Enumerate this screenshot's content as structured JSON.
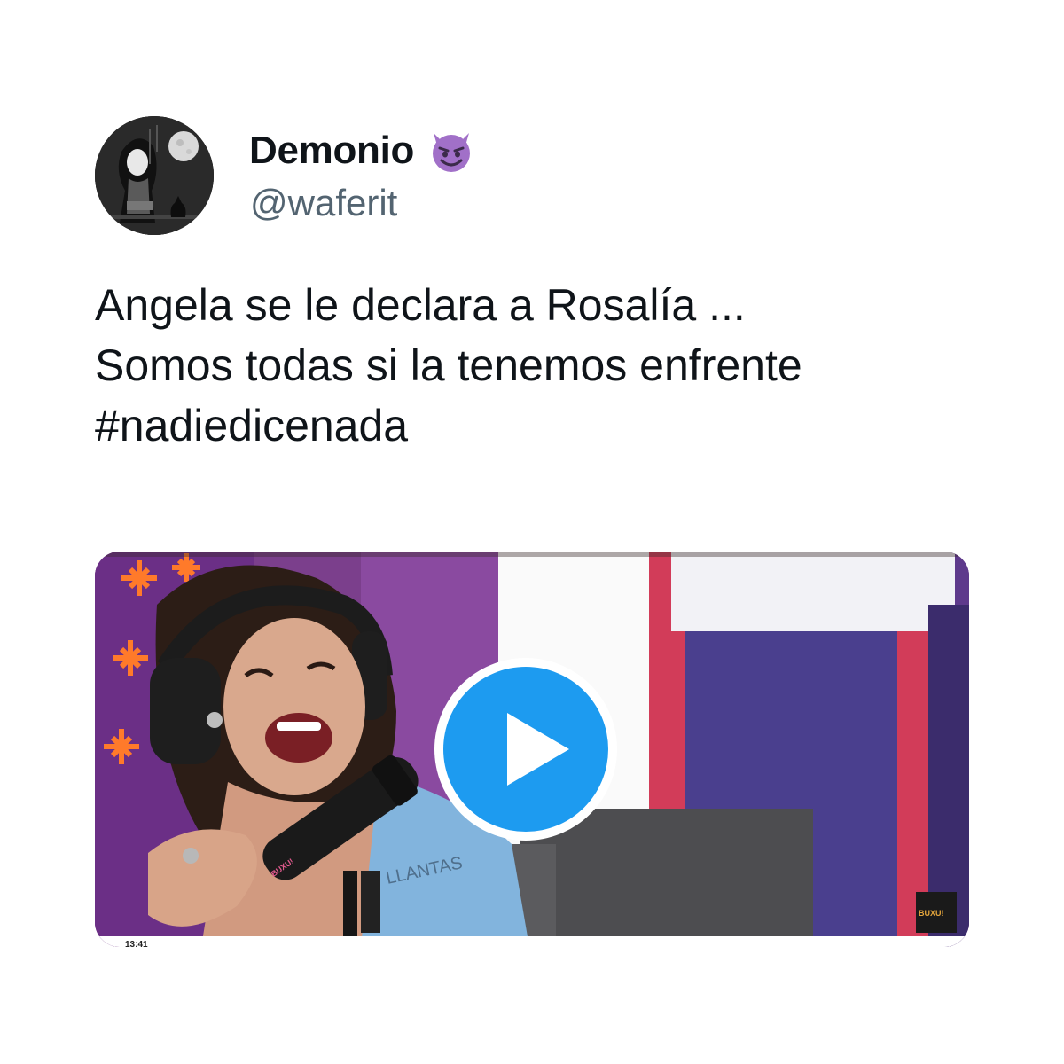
{
  "author": {
    "display_name": "Demonio",
    "emoji": "smiling-imp-emoji",
    "handle": "@waferit",
    "avatar": "profile-avatar-illustration"
  },
  "tweet": {
    "lines": [
      "Angela se le declara a Rosalía ...",
      "Somos todas si la tenemos enfrente"
    ],
    "hashtag": "#nadiedicenada"
  },
  "media": {
    "type": "video",
    "play_icon": "play-icon",
    "accent_color": "#1d9bf0",
    "on_screen_text": {
      "shirt_text": "LLANTAS",
      "mic_logo": "BUXU!",
      "corner_logo": "BUXU!",
      "timestamp": "13:41"
    }
  },
  "colors": {
    "text": "#0f1419",
    "secondary_text": "#536471",
    "emoji_purple": "#a170c8"
  }
}
